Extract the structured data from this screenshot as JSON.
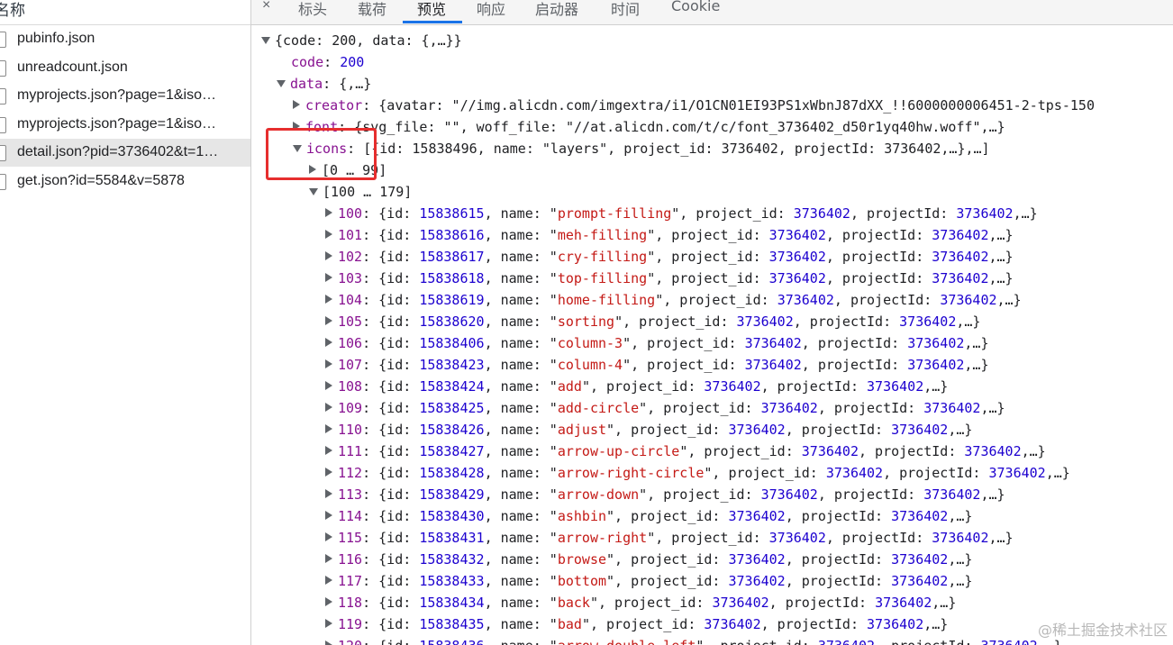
{
  "left_panel": {
    "header": "名称",
    "requests": [
      {
        "name": "pubinfo.json",
        "selected": false
      },
      {
        "name": "unreadcount.json",
        "selected": false
      },
      {
        "name": "myprojects.json?page=1&iso…",
        "selected": false
      },
      {
        "name": "myprojects.json?page=1&iso…",
        "selected": false
      },
      {
        "name": "detail.json?pid=3736402&t=1…",
        "selected": true
      },
      {
        "name": "get.json?id=5584&v=5878",
        "selected": false
      }
    ]
  },
  "tabs": {
    "close": "×",
    "items": [
      "标头",
      "载荷",
      "预览",
      "响应",
      "启动器",
      "时间",
      "Cookie"
    ],
    "active": "预览"
  },
  "tree": {
    "root": "{code: 200, data: {,…}}",
    "code_key": "code",
    "code_value": "200",
    "data_key": "data",
    "data_value": "{,…}",
    "creator_key": "creator",
    "creator_value": "{avatar: \"//img.alicdn.com/imgextra/i1/O1CN01EI93PS1xWbnJ87dXX_!!6000000006451-2-tps-150",
    "font_key": "font",
    "font_value": "{svg_file: \"\", woff_file: \"//at.alicdn.com/t/c/font_3736402_d50r1yq40hw.woff\",…}",
    "icons_key": "icons",
    "icons_value": "[{id: 15838496, name: \"layers\", project_id: 3736402, projectId: 3736402,…},…]",
    "group_collapsed": "[0 … 99]",
    "group_expanded": "[100 … 179]",
    "items": [
      {
        "index": "100",
        "id": "15838615",
        "name": "prompt-filling"
      },
      {
        "index": "101",
        "id": "15838616",
        "name": "meh-filling"
      },
      {
        "index": "102",
        "id": "15838617",
        "name": "cry-filling"
      },
      {
        "index": "103",
        "id": "15838618",
        "name": "top-filling"
      },
      {
        "index": "104",
        "id": "15838619",
        "name": "home-filling"
      },
      {
        "index": "105",
        "id": "15838620",
        "name": "sorting"
      },
      {
        "index": "106",
        "id": "15838406",
        "name": "column-3"
      },
      {
        "index": "107",
        "id": "15838423",
        "name": "column-4"
      },
      {
        "index": "108",
        "id": "15838424",
        "name": "add"
      },
      {
        "index": "109",
        "id": "15838425",
        "name": "add-circle"
      },
      {
        "index": "110",
        "id": "15838426",
        "name": "adjust"
      },
      {
        "index": "111",
        "id": "15838427",
        "name": "arrow-up-circle"
      },
      {
        "index": "112",
        "id": "15838428",
        "name": "arrow-right-circle"
      },
      {
        "index": "113",
        "id": "15838429",
        "name": "arrow-down"
      },
      {
        "index": "114",
        "id": "15838430",
        "name": "ashbin"
      },
      {
        "index": "115",
        "id": "15838431",
        "name": "arrow-right"
      },
      {
        "index": "116",
        "id": "15838432",
        "name": "browse"
      },
      {
        "index": "117",
        "id": "15838433",
        "name": "bottom"
      },
      {
        "index": "118",
        "id": "15838434",
        "name": "back"
      },
      {
        "index": "119",
        "id": "15838435",
        "name": "bad"
      },
      {
        "index": "120",
        "id": "15838436",
        "name": "arrow-double-left"
      }
    ],
    "project_id": "3736402"
  },
  "watermark": "@稀土掘金技术社区",
  "colors": {
    "highlight": "#e62e2e",
    "key": "#881391",
    "number": "#1c00cf",
    "string": "#c41a16",
    "tab_active_underline": "#1a73e8"
  }
}
